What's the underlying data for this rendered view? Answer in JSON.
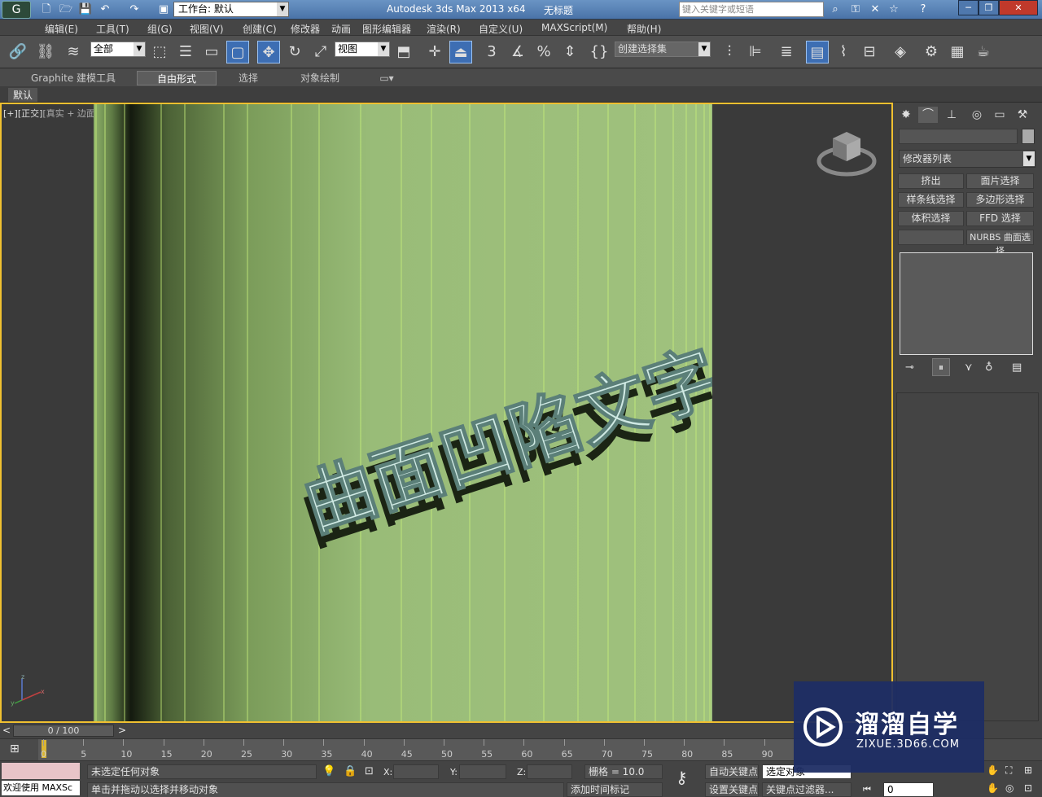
{
  "titlebar": {
    "workspace_label": "工作台: 默认",
    "app_title": "Autodesk 3ds Max  2013 x64",
    "doc_title": "无标题",
    "search_placeholder": "键入关键字或短语"
  },
  "menu": [
    "编辑(E)",
    "工具(T)",
    "组(G)",
    "视图(V)",
    "创建(C)",
    "修改器",
    "动画",
    "图形编辑器",
    "渲染(R)",
    "自定义(U)",
    "MAXScript(M)",
    "帮助(H)"
  ],
  "toolbar": {
    "selection_filter": "全部",
    "ref_coord": "视图",
    "named_selection": "创建选择集",
    "snap_label": "3"
  },
  "ribbon": {
    "tabs": [
      "Graphite 建模工具",
      "自由形式",
      "选择",
      "对象绘制"
    ],
    "active_tab": "自由形式",
    "sub_label": "默认"
  },
  "viewport": {
    "label_plus": "[+]",
    "label_view": "[正交]",
    "label_shading": "[真实 + 边面]",
    "text_3d": "曲面凹陷文字",
    "bg_color": "#8fb36a"
  },
  "command_panel": {
    "modifier_list": "修改器列表",
    "buttons": [
      "挤出",
      "面片选择",
      "样条线选择",
      "多边形选择",
      "体积选择",
      "FFD 选择",
      "",
      "NURBS 曲面选择"
    ]
  },
  "timeline": {
    "frame_counter": "0 / 100",
    "ticks": [
      "0",
      "5",
      "10",
      "15",
      "20",
      "25",
      "30",
      "35",
      "40",
      "45",
      "50",
      "55",
      "60",
      "65",
      "70",
      "75",
      "80",
      "85",
      "90"
    ]
  },
  "status": {
    "maxscript": "欢迎使用 MAXSc",
    "selection_status": "未选定任何对象",
    "prompt": "单击并拖动以选择并移动对象",
    "x_label": "X:",
    "y_label": "Y:",
    "z_label": "Z:",
    "grid": "栅格 = 10.0",
    "auto_key": "自动关键点",
    "selected_obj": "选定对象",
    "set_key": "设置关键点",
    "key_filters": "关键点过滤器...",
    "add_time_tag": "添加时间标记",
    "frame_field": "0"
  },
  "watermark": {
    "brand": "溜溜自学",
    "url": "ZIXUE.3D66.COM"
  }
}
